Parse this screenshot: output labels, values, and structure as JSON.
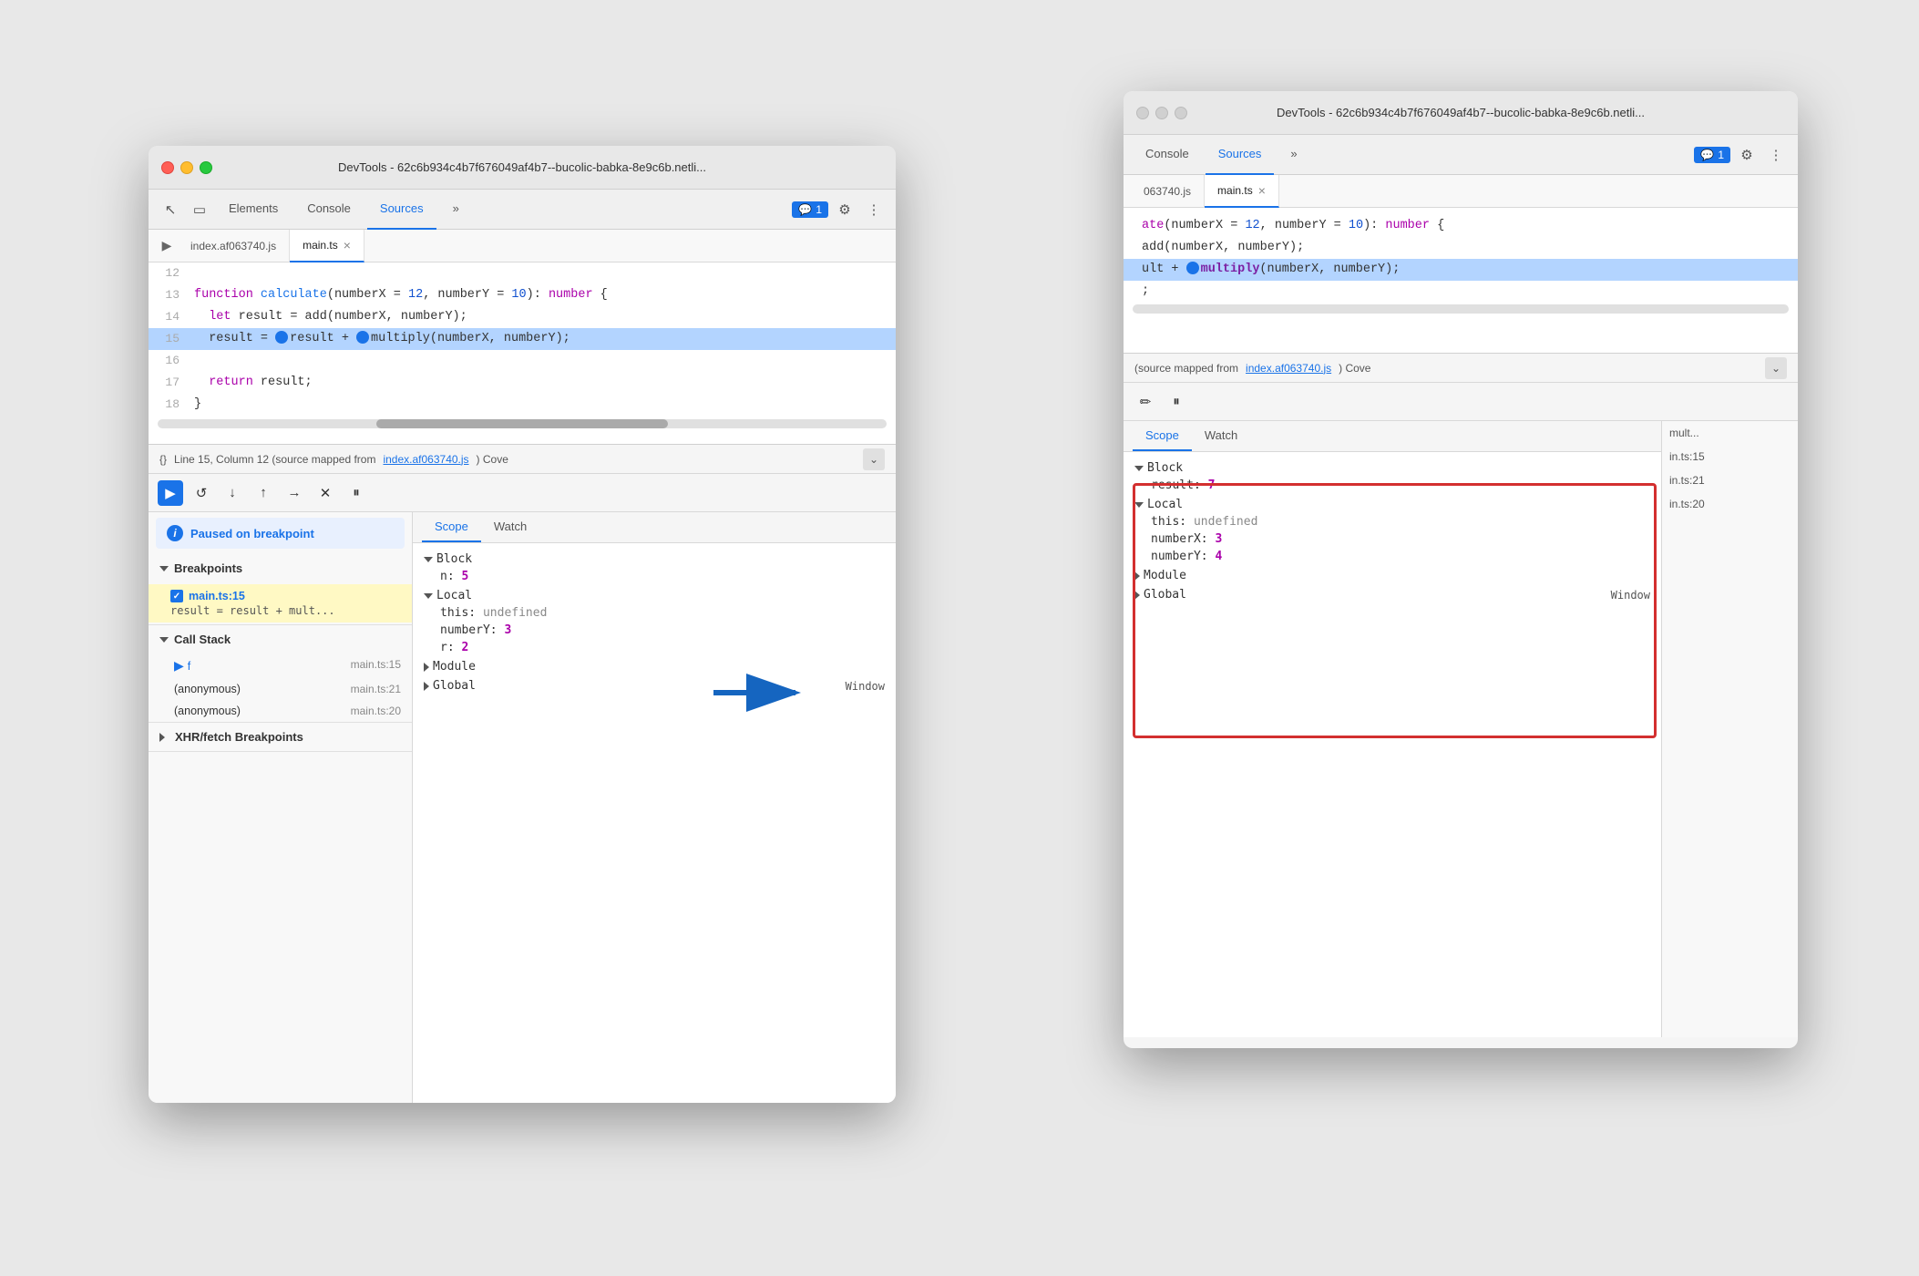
{
  "main_window": {
    "title": "DevTools - 62c6b934c4b7f676049af4b7--bucolic-babka-8e9c6b.netli...",
    "tabs": [
      "Elements",
      "Console",
      "Sources",
      "»"
    ],
    "active_tab": "Sources",
    "badge": "1",
    "file_tabs": [
      "index.af063740.js",
      "main.ts"
    ],
    "active_file": "main.ts",
    "code_lines": [
      {
        "num": "12",
        "content": "",
        "highlighted": false
      },
      {
        "num": "13",
        "content": "function calculate(numberX = 12, numberY = 10): number {",
        "highlighted": false
      },
      {
        "num": "14",
        "content": "  let result = add(numberX, numberY);",
        "highlighted": false
      },
      {
        "num": "15",
        "content": "  result = ▶result + ▶multiply(numberX, numberY);",
        "highlighted": true
      },
      {
        "num": "16",
        "content": "",
        "highlighted": false
      },
      {
        "num": "17",
        "content": "  return result;",
        "highlighted": false
      },
      {
        "num": "18",
        "content": "}",
        "highlighted": false
      }
    ],
    "status_bar": {
      "icon": "{}",
      "text": "Line 15, Column 12 (source mapped from",
      "link": "index.af063740.js",
      "suffix": ") Cove"
    },
    "paused_text": "Paused on breakpoint",
    "breakpoints_label": "Breakpoints",
    "breakpoints": [
      {
        "file": "main.ts:15",
        "code": "result = result + mult..."
      }
    ],
    "call_stack_label": "Call Stack",
    "call_stack": [
      {
        "name": "f",
        "loc": "main.ts:15",
        "active": true
      },
      {
        "name": "(anonymous)",
        "loc": "main.ts:21",
        "active": false
      },
      {
        "name": "(anonymous)",
        "loc": "main.ts:20",
        "active": false
      }
    ],
    "xhr_label": "XHR/fetch Breakpoints",
    "scope_tabs": [
      "Scope",
      "Watch"
    ],
    "scope": {
      "block": {
        "label": "Block",
        "items": [
          {
            "key": "n",
            "val": "5"
          }
        ]
      },
      "local": {
        "label": "Local",
        "items": [
          {
            "key": "this",
            "val": "undefined"
          },
          {
            "key": "numberY",
            "val": "3"
          },
          {
            "key": "r",
            "val": "2"
          }
        ]
      },
      "module": {
        "label": "Module"
      },
      "global": {
        "label": "Global",
        "val": "Window"
      }
    }
  },
  "secondary_window": {
    "title": "DevTools - 62c6b934c4b7f676049af4b7--bucolic-babka-8e9c6b.netli...",
    "tabs": [
      "Console",
      "Sources",
      "»"
    ],
    "active_tab": "Sources",
    "badge": "1",
    "file_tabs": [
      "063740.js",
      "main.ts"
    ],
    "active_file": "main.ts",
    "code_lines": [
      {
        "num": "",
        "content": "ate(numberX = 12, numberY = 10): number {"
      },
      {
        "num": "",
        "content": "add(numberX, numberY);"
      },
      {
        "num": "",
        "content": "ult + ▶multiply(numberX, numberY);",
        "highlighted": true
      },
      {
        "num": "",
        "content": ";"
      }
    ],
    "status_bar": {
      "text": "(source mapped from",
      "link": "index.af063740.js",
      "suffix": ") Cove"
    },
    "scope_tabs": [
      "Scope",
      "Watch"
    ],
    "scope": {
      "block": {
        "label": "Block",
        "items": [
          {
            "key": "result",
            "val": "7"
          }
        ]
      },
      "local": {
        "label": "Local",
        "items": [
          {
            "key": "this",
            "val": "undefined"
          },
          {
            "key": "numberX",
            "val": "3"
          },
          {
            "key": "numberY",
            "val": "4"
          }
        ]
      },
      "module": {
        "label": "Module"
      },
      "global": {
        "label": "Global",
        "val": "Window"
      }
    },
    "call_stack_items": [
      "mult...",
      "in.ts:15",
      "in.ts:21",
      "in.ts:20"
    ]
  }
}
